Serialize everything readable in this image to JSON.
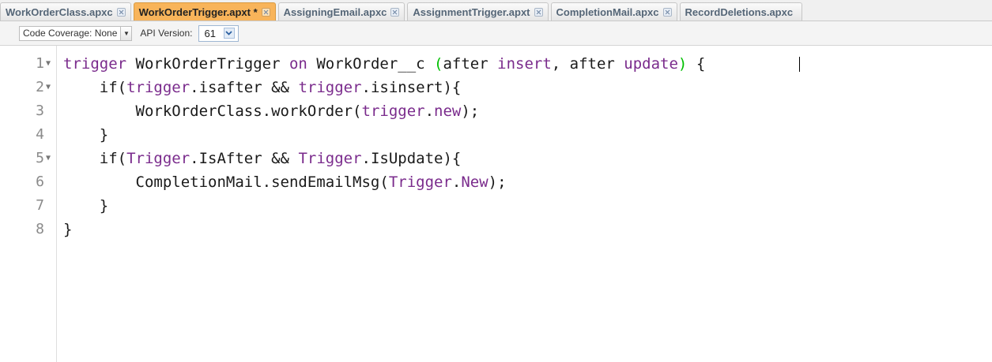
{
  "tabs": [
    {
      "label": "WorkOrderClass.apxc",
      "active": false
    },
    {
      "label": "WorkOrderTrigger.apxt *",
      "active": true
    },
    {
      "label": "AssigningEmail.apxc",
      "active": false
    },
    {
      "label": "AssignmentTrigger.apxt",
      "active": false
    },
    {
      "label": "CompletionMail.apxc",
      "active": false
    },
    {
      "label": "RecordDeletions.apxc",
      "active": false
    }
  ],
  "toolbar": {
    "code_coverage": "Code Coverage: None",
    "api_version_label": "API Version:",
    "api_version_value": "61"
  },
  "editor": {
    "line_numbers": [
      "1",
      "2",
      "3",
      "4",
      "5",
      "6",
      "7",
      "8"
    ],
    "lines": [
      "trigger WorkOrderTrigger on WorkOrder__c (after insert, after update) {",
      "    if(trigger.isafter && trigger.isinsert){",
      "        WorkOrderClass.workOrder(trigger.new);",
      "    }",
      "    if(Trigger.IsAfter && Trigger.IsUpdate){",
      "        CompletionMail.sendEmailMsg(Trigger.New);",
      "    }",
      "}"
    ],
    "foldable_lines": [
      "1",
      "2",
      "5"
    ]
  },
  "colors": {
    "keyword": "#7a2b8c",
    "active_tab": "#f8b45a",
    "matching_paren": "#00c000"
  }
}
